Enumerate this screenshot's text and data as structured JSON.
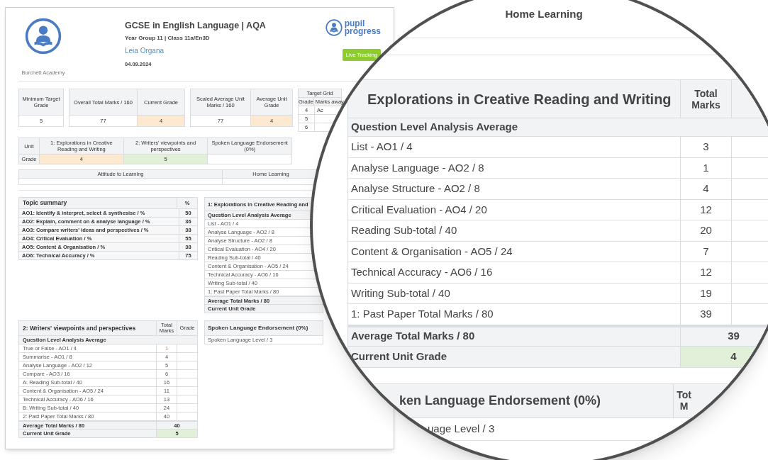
{
  "school": {
    "name": "Burchett Academy"
  },
  "header": {
    "title": "GCSE in English Language | AQA",
    "subtitle": "Year Group 11 | Class 11a/En3D",
    "student": "Leia Organa",
    "date": "04.09.2024"
  },
  "brand": {
    "line1": "pupil",
    "line2": "progress"
  },
  "live_button": "Live Tracking",
  "summary_boxes": [
    {
      "cells": [
        {
          "label": "Minimum Target Grade",
          "value": "5"
        }
      ]
    },
    {
      "cells": [
        {
          "label": "Overall Total Marks / 160",
          "value": "77"
        },
        {
          "label": "Current Grade",
          "value": "4",
          "color": "#fde9cf"
        }
      ]
    },
    {
      "cells": [
        {
          "label": "Scaled Average Unit Marks / 160",
          "value": "77"
        },
        {
          "label": "Average Unit Grade",
          "value": "4",
          "color": "#fde9cf"
        }
      ]
    }
  ],
  "target_grid": {
    "title": "Target Grid",
    "columns": [
      "Grade",
      "Marks away"
    ],
    "rows": [
      {
        "grade": "4",
        "marks": "Ac"
      },
      {
        "grade": "5"
      },
      {
        "grade": "6"
      }
    ]
  },
  "units": {
    "header_label": "Unit",
    "row_label": "Grade",
    "columns": [
      {
        "name": "1: Explorations in Creative Reading and Writing",
        "grade": "4",
        "color": "#fde9cf"
      },
      {
        "name": "2: Writers' viewpoints and perspectives",
        "grade": "5",
        "color": "#e2efd9"
      },
      {
        "name": "Spoken Language Endorsement (0%)"
      }
    ]
  },
  "attitude": {
    "columns": [
      "Attitude to Learning",
      "Home Learning"
    ]
  },
  "topic_summary": {
    "title": "Topic summary",
    "column": "%",
    "rows": [
      {
        "label": "AO1: Identify & interpret, select & synthesise / %",
        "value": "50"
      },
      {
        "label": "AO2: Explain, comment on & analyse language / %",
        "value": "36"
      },
      {
        "label": "AO3: Compare writers' ideas and perspectives / %",
        "value": "38"
      },
      {
        "label": "AO4: Critical Evaluation / %",
        "value": "55"
      },
      {
        "label": "AO5: Content & Organisation / %",
        "value": "38"
      },
      {
        "label": "AO6: Technical Accuracy / %",
        "value": "75"
      }
    ]
  },
  "unit1_table": {
    "title": "1: Explorations in Creative Reading and",
    "section": "Question Level Analysis Average",
    "rows": [
      "List - AO1 / 4",
      "Analyse Language - AO2 / 8",
      "Analyse Structure - AO2 / 8",
      "Critical Evaluation - AO4 / 20",
      "Reading Sub-total / 40",
      "Content & Organisation - AO5 / 24",
      "Technical Accuracy - AO6 / 16",
      "Writing Sub-total / 40",
      "1: Past Paper Total Marks / 80"
    ],
    "footer": [
      "Average Total Marks / 80",
      "Current Unit Grade"
    ]
  },
  "unit2_table": {
    "title": "2: Writers' viewpoints and perspectives",
    "columns": [
      "Total Marks",
      "Grade"
    ],
    "section": "Question Level Analysis Average",
    "rows": [
      {
        "label": "True or False - AO1 / 4",
        "value": "1",
        "flagged": true
      },
      {
        "label": "Summarise - AO1 / 8",
        "value": "4",
        "flagged": false
      },
      {
        "label": "Analyse Language - AO2 / 12",
        "value": "5",
        "flagged": false
      },
      {
        "label": "Compare - AO3 / 16",
        "value": "6",
        "flagged": false
      },
      {
        "label": "A: Reading Sub-total / 40",
        "value": "16",
        "flagged": false
      },
      {
        "label": "Content & Organisation - AO5 / 24",
        "value": "11",
        "flagged": false
      },
      {
        "label": "Technical Accuracy - AO6 / 16",
        "value": "13",
        "flagged": false
      },
      {
        "label": "B: Writing Sub-total / 40",
        "value": "24",
        "flagged": false
      },
      {
        "label": "2: Past Paper Total Marks / 80",
        "value": "40",
        "flagged": false
      }
    ],
    "footer": [
      {
        "label": "Average Total Marks / 80",
        "value": "40"
      },
      {
        "label": "Current Unit Grade",
        "value": "5",
        "color": "#e2efd9"
      }
    ]
  },
  "spoken_table": {
    "title": "Spoken Language Endorsement (0%)",
    "rows": [
      "Spoken Language Level / 3"
    ]
  },
  "magnifier": {
    "top_label": "Home Learning",
    "unit_table": {
      "title": "Explorations in Creative Reading and Writing",
      "column": "Total Marks",
      "section": "Question Level Analysis Average",
      "rows": [
        {
          "label": "List - AO1 / 4",
          "value": "3"
        },
        {
          "label": "Analyse Language - AO2 / 8",
          "value": "1"
        },
        {
          "label": "Analyse Structure - AO2 / 8",
          "value": "4"
        },
        {
          "label": "Critical Evaluation - AO4 / 20",
          "value": "12"
        },
        {
          "label": "Reading Sub-total / 40",
          "value": "20"
        },
        {
          "label": "Content & Organisation - AO5 / 24",
          "value": "7"
        },
        {
          "label": "Technical Accuracy - AO6 / 16",
          "value": "12"
        },
        {
          "label": "Writing Sub-total / 40",
          "value": "19"
        },
        {
          "label": "1: Past Paper Total Marks / 80",
          "value": "39"
        }
      ],
      "footer": [
        {
          "label": "Average Total Marks / 80",
          "value": "39"
        },
        {
          "label": "Current Unit Grade",
          "value": "4",
          "color": "#e2efd9"
        }
      ]
    },
    "spoken": {
      "title": "ken Language Endorsement (0%)",
      "column": "Tot M",
      "rows": [
        "uage Level / 3"
      ]
    }
  }
}
